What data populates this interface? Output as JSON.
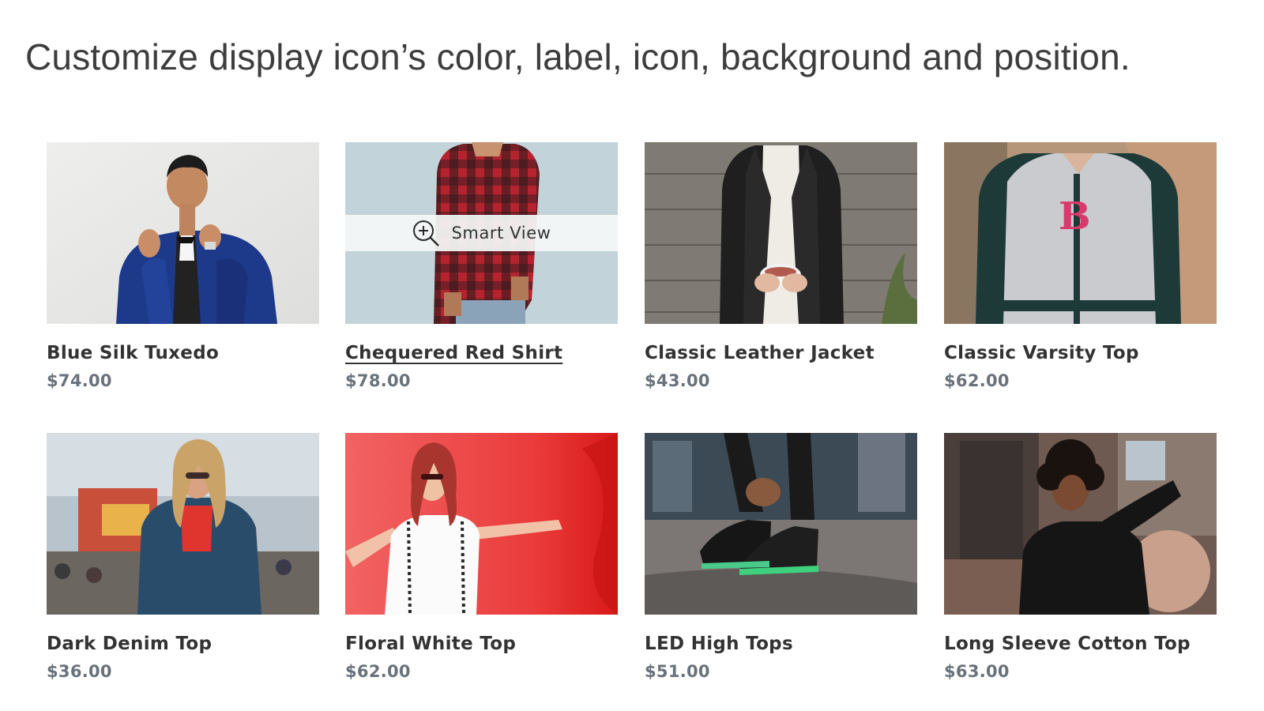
{
  "headline": "Customize display icon’s color, label, icon, background and position.",
  "smart_view": {
    "label": "Smart View",
    "icon": "zoom-in-icon",
    "background": "#f4f6f6",
    "text_color": "#333333"
  },
  "colors": {
    "title": "#333333",
    "price": "#69727b",
    "headline": "#3d3d3d"
  },
  "products": [
    {
      "name": "Blue Silk Tuxedo",
      "price": "$74.00",
      "image": "man in blue silk tuxedo jacket adjusting bow tie",
      "hovered": false
    },
    {
      "name": "Chequered Red Shirt",
      "price": "$78.00",
      "image": "man in red checkered shirt on light blue background",
      "hovered": true
    },
    {
      "name": "Classic Leather Jacket",
      "price": "$43.00",
      "image": "woman in black leather jacket holding tea cup",
      "hovered": false
    },
    {
      "name": "Classic Varsity Top",
      "price": "$62.00",
      "image": "woman in grey varsity jacket with pink B letter",
      "hovered": false
    },
    {
      "name": "Dark Denim Top",
      "price": "$36.00",
      "image": "woman in denim jacket at fairground",
      "hovered": false
    },
    {
      "name": "Floral White Top",
      "price": "$62.00",
      "image": "woman in white top against red wall",
      "hovered": false
    },
    {
      "name": "LED High Tops",
      "price": "$51.00",
      "image": "black high top sneakers with green LED soles",
      "hovered": false
    },
    {
      "name": "Long Sleeve Cotton Top",
      "price": "$63.00",
      "image": "woman in black long sleeve top with ball",
      "hovered": false
    }
  ]
}
